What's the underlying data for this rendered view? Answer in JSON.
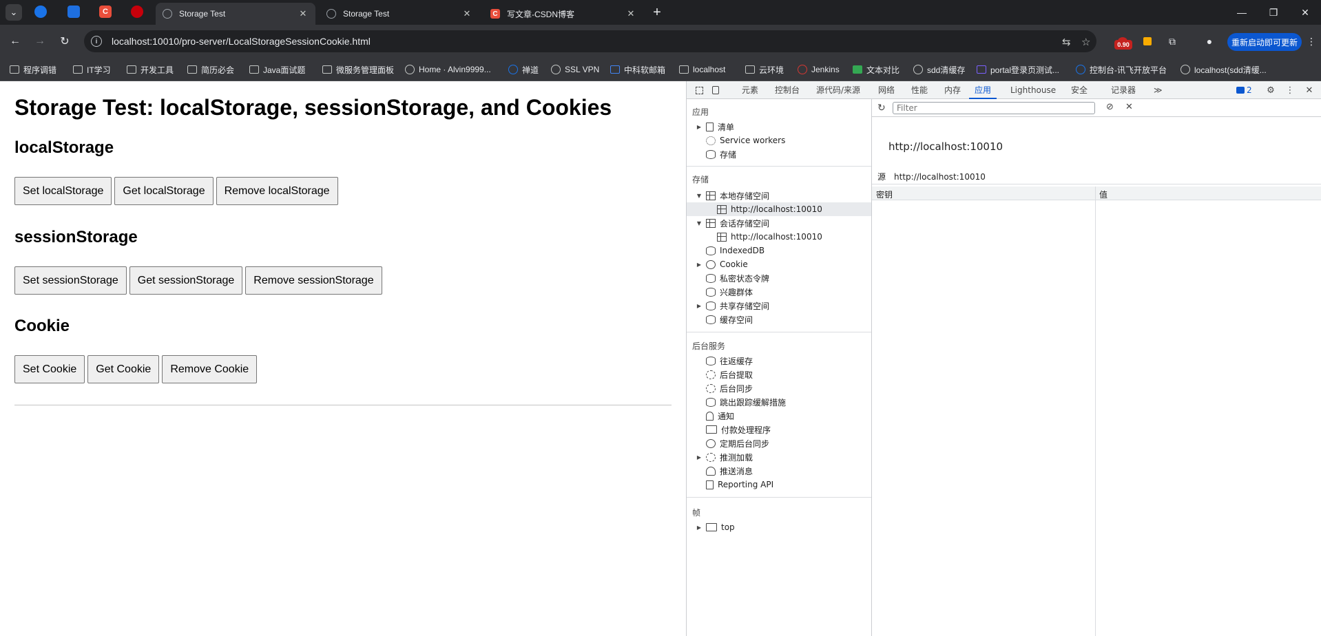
{
  "tabstrip": {
    "tabs": [
      {
        "label": "Storage Test",
        "active": true
      },
      {
        "label": "Storage Test",
        "active": false
      },
      {
        "label": "写文章-CSDN博客",
        "active": false
      }
    ],
    "new_tab": "+",
    "search": "⌄",
    "pinned": [
      "C"
    ],
    "controls": {
      "minimize": "—",
      "restore": "❐",
      "close": "✕"
    },
    "close_glyph": "✕"
  },
  "toolbar": {
    "url": "localhost:10010/pro-server/LocalStorageSessionCookie.html",
    "back": "←",
    "forward": "→",
    "reload": "↻",
    "info": "i",
    "translate": "⇆",
    "star": "☆",
    "ext_badge": "0.90",
    "puzzle": "⧉",
    "profile": "●",
    "relaunch": "重新启动即可更新",
    "menu": "⋮"
  },
  "bookmarks": [
    "程序调错",
    "IT学习",
    "开发工具",
    "简历必会",
    "Java面试题",
    "微服务管理面板",
    "Home · Alvin9999...",
    "禅道",
    "SSL VPN",
    "中科软邮箱",
    "localhost",
    "云环境",
    "Jenkins",
    "文本对比",
    "sdd清缓存",
    "portal登录页测试...",
    "控制台-讯飞开放平台",
    "localhost(sdd清缓..."
  ],
  "page": {
    "title": "Storage Test: localStorage, sessionStorage, and Cookies",
    "sections": [
      {
        "heading": "localStorage",
        "buttons": [
          "Set localStorage",
          "Get localStorage",
          "Remove localStorage"
        ]
      },
      {
        "heading": "sessionStorage",
        "buttons": [
          "Set sessionStorage",
          "Get sessionStorage",
          "Remove sessionStorage"
        ]
      },
      {
        "heading": "Cookie",
        "buttons": [
          "Set Cookie",
          "Get Cookie",
          "Remove Cookie"
        ]
      }
    ]
  },
  "devtools": {
    "tabs": [
      "元素",
      "控制台",
      "源代码/来源",
      "网络",
      "性能",
      "内存",
      "应用",
      "Lighthouse",
      "安全",
      "记录器"
    ],
    "active_tab": "应用",
    "more": "≫",
    "issues_count": "2",
    "settings": "⚙",
    "kebab": "⋮",
    "close": "✕",
    "sidebar": {
      "app_title": "应用",
      "app_items": [
        "清单",
        "Service workers",
        "存储"
      ],
      "storage_title": "存储",
      "storage_items": [
        "本地存储空间",
        "http://localhost:10010",
        "会话存储空间",
        "http://localhost:10010",
        "IndexedDB",
        "Cookie",
        "私密状态令牌",
        "兴趣群体",
        "共享存储空间",
        "缓存空间"
      ],
      "bg_title": "后台服务",
      "bg_items": [
        "往返缓存",
        "后台提取",
        "后台同步",
        "跳出跟踪缓解措施",
        "通知",
        "付款处理程序",
        "定期后台同步",
        "推测加载",
        "推送消息",
        "Reporting API"
      ],
      "frames_title": "帧",
      "frames_items": [
        "top"
      ]
    },
    "main": {
      "filter_placeholder": "Filter",
      "origin_title": "http://localhost:10010",
      "origin_label": "源",
      "origin_value": "http://localhost:10010",
      "key_header": "密钥",
      "value_header": "值"
    }
  }
}
